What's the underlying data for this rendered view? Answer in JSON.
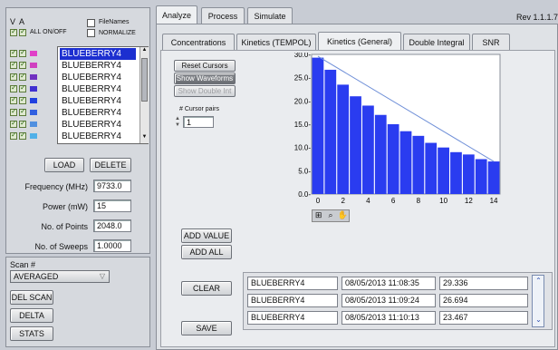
{
  "left": {
    "v_header": "V",
    "a_header": "A",
    "all_onoff_label": "ALL ON/OFF",
    "filenames_label": "FileNames",
    "normalize_label": "NORMALIZE",
    "files": [
      "BLUEBERRY4",
      "BLUEBERRY4",
      "BLUEBERRY4",
      "BLUEBERRY4",
      "BLUEBERRY4",
      "BLUEBERRY4",
      "BLUEBERRY4",
      "BLUEBERRY4"
    ],
    "swatch_colors": [
      "#e040c8",
      "#d040c0",
      "#7030c0",
      "#4030d0",
      "#2040e0",
      "#3060e0",
      "#5090e0",
      "#50b0e8"
    ],
    "load_label": "LOAD",
    "delete_label": "DELETE",
    "frequency_label": "Frequency (MHz)",
    "frequency_value": "9733.0",
    "power_label": "Power (mW)",
    "power_value": "15",
    "points_label": "No. of Points",
    "points_value": "2048.0",
    "sweeps_label": "No. of Sweeps",
    "sweeps_value": "1.0000",
    "scan_label": "Scan #",
    "scan_mode": "AVERAGED",
    "del_scan_label": "DEL SCAN",
    "delta_label": "DELTA",
    "stats_label": "STATS"
  },
  "top_tabs": [
    "Analyze",
    "Process",
    "Simulate"
  ],
  "revision": "Rev 1.1.1.7",
  "sub_tabs": [
    "Concentrations",
    "Kinetics (TEMPOL)",
    "Kinetics (General)",
    "Double Integral",
    "SNR"
  ],
  "controls": {
    "reset_cursors": "Reset Cursors",
    "show_waveforms": "Show Waveforms",
    "show_double_int": "Show Double Int",
    "cursor_pairs_label": "# Cursor pairs",
    "cursor_pairs_value": "1",
    "add_value": "ADD VALUE",
    "add_all": "ADD ALL",
    "clear": "CLEAR",
    "save": "SAVE"
  },
  "results": [
    {
      "name": "BLUEBERRY4",
      "time": "08/05/2013 11:08:35",
      "value": "29.336"
    },
    {
      "name": "BLUEBERRY4",
      "time": "08/05/2013 11:09:24",
      "value": "26.694"
    },
    {
      "name": "BLUEBERRY4",
      "time": "08/05/2013 11:10:13",
      "value": "23.467"
    }
  ],
  "chart_data": {
    "type": "bar",
    "x": [
      0,
      1,
      2,
      3,
      4,
      5,
      6,
      7,
      8,
      9,
      10,
      11,
      12,
      13,
      14
    ],
    "values": [
      29.3,
      26.7,
      23.5,
      21.0,
      19.0,
      17.0,
      15.0,
      13.5,
      12.5,
      11.0,
      10.0,
      9.0,
      8.5,
      7.5,
      7.0
    ],
    "fit_line": [
      [
        0,
        29.6
      ],
      [
        14,
        7.0
      ]
    ],
    "xlim": [
      -0.5,
      14.5
    ],
    "ylim": [
      0,
      30
    ],
    "x_ticks": [
      "0",
      "2",
      "4",
      "6",
      "8",
      "10",
      "12",
      "14"
    ],
    "y_ticks": [
      "0.0-",
      "5.0-",
      "10.0-",
      "15.0-",
      "20.0-",
      "25.0-",
      "30.0-"
    ],
    "bar_color": "#2a3cf0",
    "fit_color": "#7090d8",
    "grid": false
  }
}
